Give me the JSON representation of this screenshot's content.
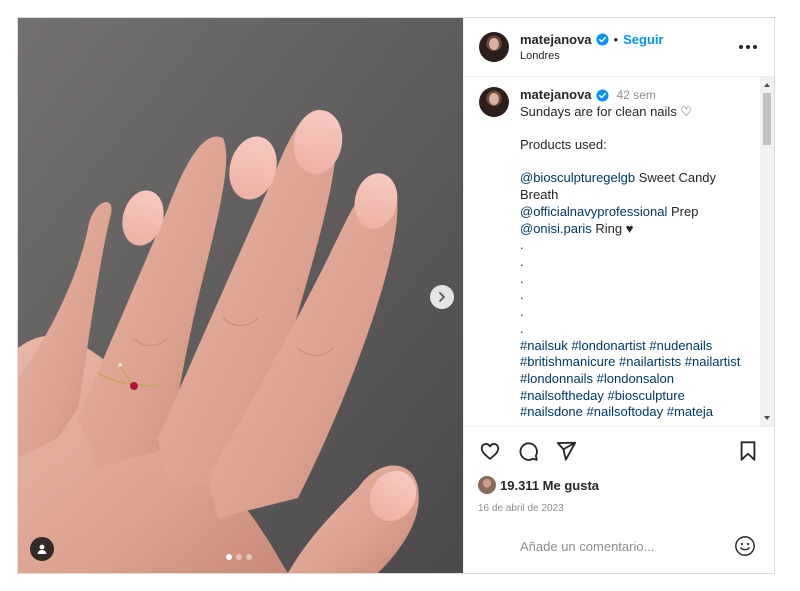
{
  "header": {
    "username": "matejanova",
    "separator": "•",
    "follow_label": "Seguir",
    "location": "Londres"
  },
  "caption": {
    "username": "matejanova",
    "time": "42 sem",
    "lines": [
      {
        "parts": [
          {
            "t": "text",
            "v": "Sundays are for clean nails ♡"
          }
        ]
      },
      {
        "parts": [
          {
            "t": "text",
            "v": ""
          }
        ]
      },
      {
        "parts": [
          {
            "t": "text",
            "v": "Products used:"
          }
        ]
      },
      {
        "parts": [
          {
            "t": "text",
            "v": ""
          }
        ]
      },
      {
        "parts": [
          {
            "t": "mention",
            "v": "@biosculpturegelgb"
          },
          {
            "t": "text",
            "v": " Sweet Candy"
          }
        ]
      },
      {
        "parts": [
          {
            "t": "text",
            "v": "Breath"
          }
        ]
      },
      {
        "parts": [
          {
            "t": "mention",
            "v": "@officialnavyprofessional"
          },
          {
            "t": "text",
            "v": " Prep"
          }
        ]
      },
      {
        "parts": [
          {
            "t": "mention",
            "v": "@onisi.paris"
          },
          {
            "t": "text",
            "v": " Ring ♥"
          }
        ]
      },
      {
        "parts": [
          {
            "t": "text",
            "v": "."
          }
        ]
      },
      {
        "parts": [
          {
            "t": "text",
            "v": "."
          }
        ]
      },
      {
        "parts": [
          {
            "t": "text",
            "v": "."
          }
        ]
      },
      {
        "parts": [
          {
            "t": "text",
            "v": "."
          }
        ]
      },
      {
        "parts": [
          {
            "t": "text",
            "v": "."
          }
        ]
      },
      {
        "parts": [
          {
            "t": "text",
            "v": "."
          }
        ]
      },
      {
        "parts": [
          {
            "t": "hash",
            "v": "#nailsuk"
          },
          {
            "t": "text",
            "v": " "
          },
          {
            "t": "hash",
            "v": "#londonartist"
          },
          {
            "t": "text",
            "v": " "
          },
          {
            "t": "hash",
            "v": "#nudenails"
          }
        ]
      },
      {
        "parts": [
          {
            "t": "hash",
            "v": "#britishmanicure"
          },
          {
            "t": "text",
            "v": " "
          },
          {
            "t": "hash",
            "v": "#nailartists"
          },
          {
            "t": "text",
            "v": " "
          },
          {
            "t": "hash",
            "v": "#nailartist"
          }
        ]
      },
      {
        "parts": [
          {
            "t": "hash",
            "v": "#londonnails"
          },
          {
            "t": "text",
            "v": " "
          },
          {
            "t": "hash",
            "v": "#londonsalon"
          }
        ]
      },
      {
        "parts": [
          {
            "t": "hash",
            "v": "#nailsoftheday"
          },
          {
            "t": "text",
            "v": " "
          },
          {
            "t": "hash",
            "v": "#biosculpture"
          }
        ]
      },
      {
        "parts": [
          {
            "t": "hash",
            "v": "#nailsdone"
          },
          {
            "t": "text",
            "v": " "
          },
          {
            "t": "hash",
            "v": "#nailsoftoday"
          },
          {
            "t": "text",
            "v": " "
          },
          {
            "t": "hash",
            "v": "#mateja"
          }
        ]
      }
    ]
  },
  "actions": {
    "likes_label": "19.311 Me gusta",
    "date": "16 de abril de 2023"
  },
  "comment": {
    "placeholder": "Añade un comentario..."
  },
  "carousel": {
    "slide_count": 3,
    "active_index": 0
  },
  "colors": {
    "link": "#00376b",
    "follow": "#0095f6",
    "verified": "#0095f6",
    "muted": "#8e8e8e"
  },
  "icons": [
    "heart-icon",
    "comment-icon",
    "share-icon",
    "bookmark-icon",
    "more-icon",
    "verified-icon",
    "chevron-right-icon",
    "user-tag-icon",
    "emoji-icon"
  ]
}
